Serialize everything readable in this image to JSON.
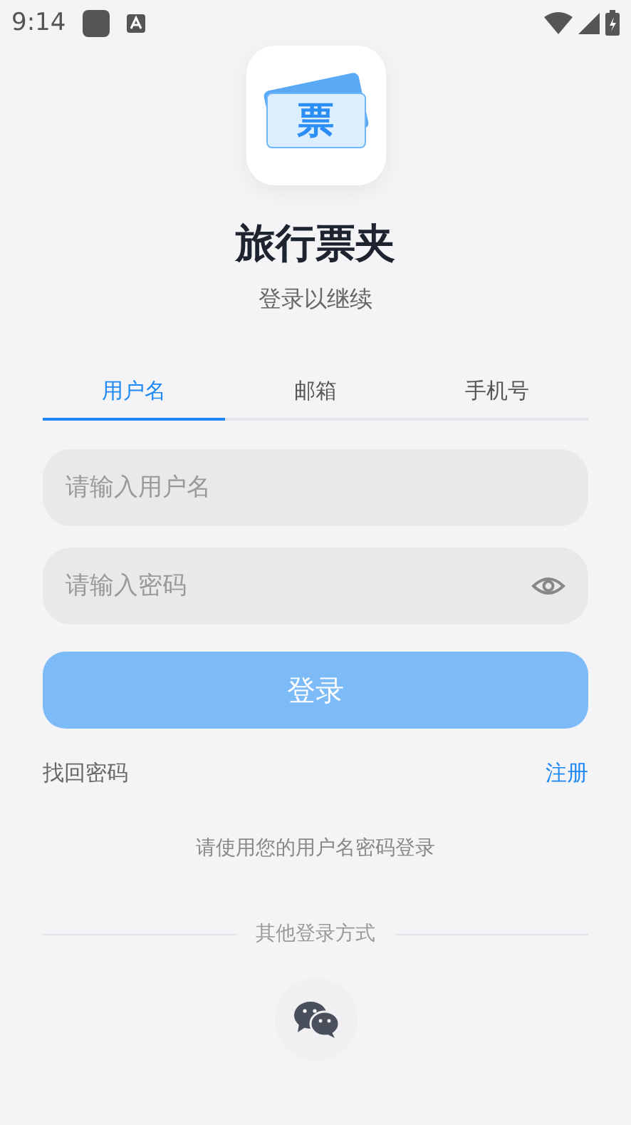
{
  "status_bar": {
    "time": "9:14"
  },
  "app": {
    "logo_text": "票",
    "title": "旅行票夹",
    "subtitle": "登录以继续"
  },
  "tabs": [
    {
      "label": "用户名",
      "selected": true
    },
    {
      "label": "邮箱",
      "selected": false
    },
    {
      "label": "手机号",
      "selected": false
    }
  ],
  "username_field": {
    "placeholder": "请输入用户名"
  },
  "password_field": {
    "placeholder": "请输入密码"
  },
  "login_button": {
    "label": "登录",
    "disabled": true
  },
  "links": {
    "forgot": "找回密码",
    "register": "注册"
  },
  "hint": "请使用您的用户名密码登录",
  "other_login": {
    "label": "其他登录方式"
  }
}
